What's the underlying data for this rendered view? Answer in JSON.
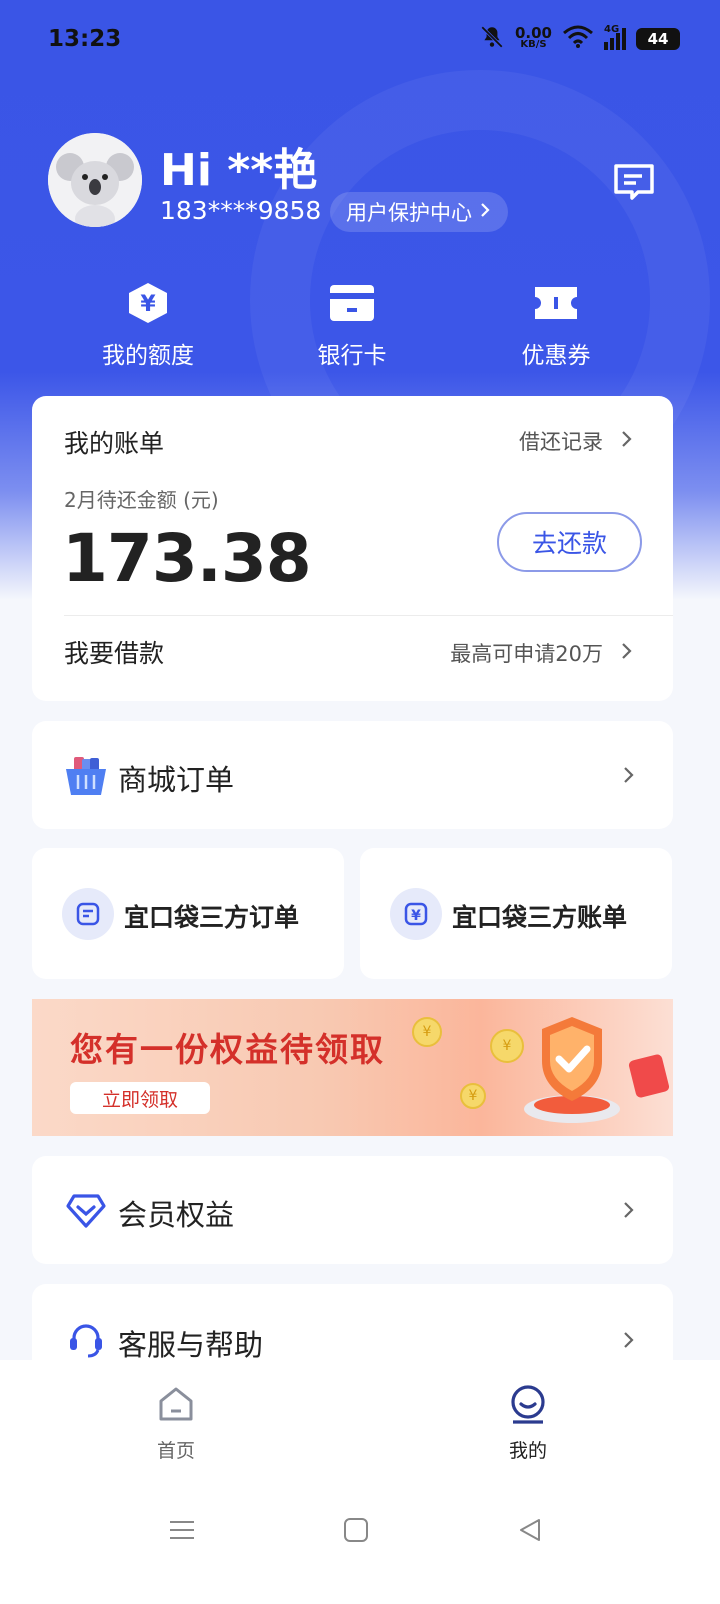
{
  "status": {
    "time": "13:23",
    "net_speed_value": "0.00",
    "net_speed_unit": "KB/S",
    "network_type": "4G",
    "battery": "44"
  },
  "profile": {
    "greeting": "Hi **艳",
    "phone": "183****9858",
    "protect_link": "用户保护中心"
  },
  "quick_actions": [
    {
      "label": "我的额度",
      "icon": "yuan-shield-icon"
    },
    {
      "label": "银行卡",
      "icon": "card-icon"
    },
    {
      "label": "优惠券",
      "icon": "coupon-icon"
    }
  ],
  "bill": {
    "title": "我的账单",
    "record_link": "借还记录",
    "due_label": "2月待还金额 (元)",
    "amount": "173.38",
    "repay_button": "去还款",
    "borrow_title": "我要借款",
    "borrow_info": "最高可申请20万"
  },
  "mall": {
    "label": "商城订单"
  },
  "third_party": {
    "orders_label": "宜口袋三方订单",
    "bills_label": "宜口袋三方账单"
  },
  "banner": {
    "title": "您有一份权益待领取",
    "button": "立即领取"
  },
  "member": {
    "label": "会员权益"
  },
  "help": {
    "label": "客服与帮助"
  },
  "tabs": [
    {
      "label": "首页",
      "active": false
    },
    {
      "label": "我的",
      "active": true
    }
  ],
  "colors": {
    "brand": "#3a55e6",
    "background": "#f5f7fc",
    "banner_red": "#d4302a"
  }
}
